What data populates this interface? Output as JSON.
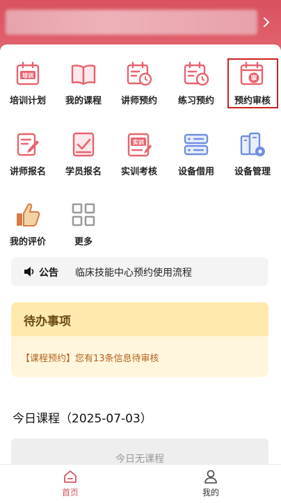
{
  "header": {
    "bar_text": "",
    "chevron": "chevron-right-icon"
  },
  "grid": {
    "items": [
      {
        "label": "培训计划",
        "icon": "training-plan-icon",
        "badge": "培训"
      },
      {
        "label": "我的课程",
        "icon": "book-icon"
      },
      {
        "label": "讲师预约",
        "icon": "calendar-clock-icon"
      },
      {
        "label": "练习预约",
        "icon": "calendar-clock-icon"
      },
      {
        "label": "预约审核",
        "icon": "calendar-review-icon",
        "badge": "审"
      },
      {
        "label": "讲师报名",
        "icon": "edit-form-icon"
      },
      {
        "label": "学员报名",
        "icon": "checklist-icon"
      },
      {
        "label": "实训考核",
        "icon": "practical-exam-icon",
        "badge": "实训"
      },
      {
        "label": "设备借用",
        "icon": "server-icon"
      },
      {
        "label": "设备管理",
        "icon": "device-settings-icon"
      },
      {
        "label": "我的评价",
        "icon": "thumbs-up-icon"
      },
      {
        "label": "更多",
        "icon": "grid-more-icon"
      }
    ]
  },
  "notice": {
    "icon": "speaker-icon",
    "tag": "公告",
    "text": "临床技能中心预约使用流程"
  },
  "todo": {
    "title": "待办事项",
    "item": "【课程预约】您有13条信息待审核"
  },
  "today": {
    "title": "今日课程（2025-07-03）",
    "empty": "今日无课程"
  },
  "tabbar": {
    "items": [
      {
        "label": "首页",
        "icon": "home-icon",
        "active": true
      },
      {
        "label": "我的",
        "icon": "user-icon",
        "active": false
      }
    ]
  },
  "colors": {
    "brand": "#d9525e",
    "icon_red": "#e8636c",
    "icon_blue": "#6f8fe0",
    "icon_orange": "#d97c44",
    "icon_gray": "#9a9a9a",
    "todo_header": "#ffe9ad",
    "todo_body": "#fff6dd",
    "todo_text": "#b4621c",
    "highlight": "#cc1f1f"
  }
}
